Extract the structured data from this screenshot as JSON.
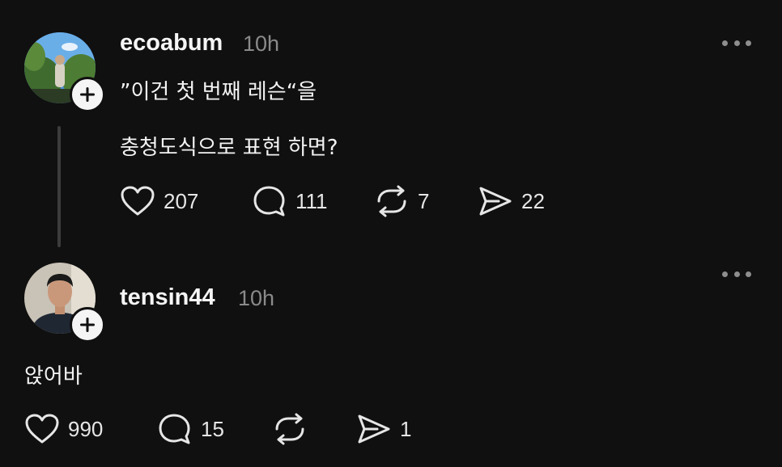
{
  "posts": [
    {
      "username": "ecoabum",
      "time": "10h",
      "lines": [
        "”이건 첫 번째 레슨“을",
        "충청도식으로 표현 하면?"
      ],
      "actions": {
        "likes": "207",
        "replies": "111",
        "reposts": "7",
        "shares": "22"
      }
    },
    {
      "username": "tensin44",
      "time": "10h",
      "lines": [
        "앉어바"
      ],
      "actions": {
        "likes": "990",
        "replies": "15",
        "reposts": "",
        "shares": "1"
      }
    }
  ],
  "colors": {
    "background": "#101010",
    "text": "#f3f3f3",
    "muted": "#8a8a8a",
    "thread_line": "#3c3c3c"
  },
  "icons": [
    "heart-icon",
    "comment-icon",
    "repost-icon",
    "share-icon",
    "plus-icon",
    "more-icon"
  ]
}
